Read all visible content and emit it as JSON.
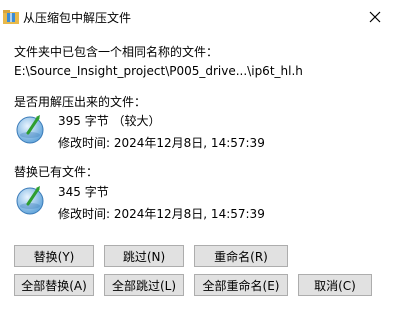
{
  "window": {
    "title": "从压缩包中解压文件"
  },
  "prompt": {
    "question": "文件夹中已包含一个相同名称的文件：",
    "path": "E:\\Source_Insight_project\\P005_drive...\\ip6t_hl.h"
  },
  "replace_with": {
    "heading": "是否用解压出来的文件：",
    "size": "395 字节 （较大）",
    "modified": "修改时间: 2024年12月8日, 14:57:39"
  },
  "existing": {
    "heading": "替换已有文件：",
    "size": "345 字节",
    "modified": "修改时间: 2024年12月8日, 14:57:39"
  },
  "buttons": {
    "replace": "替换(Y)",
    "skip": "跳过(N)",
    "rename": "重命名(R)",
    "replace_all": "全部替换(A)",
    "skip_all": "全部跳过(L)",
    "rename_all": "全部重命名(E)",
    "cancel": "取消(C)"
  },
  "icons": {
    "title": "folder-zip-icon",
    "file": "globe-file-icon",
    "close": "close-icon"
  },
  "colors": {
    "background": "#ffffff",
    "button_bg": "#e1e1e1",
    "button_border": "#adadad"
  }
}
